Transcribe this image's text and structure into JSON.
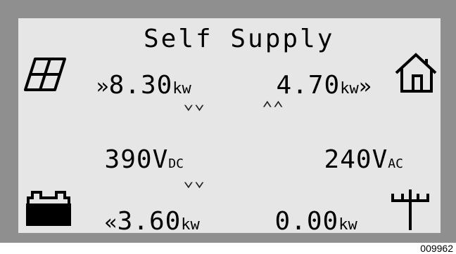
{
  "screen": {
    "title": "Self Supply",
    "solar": {
      "prefix": "»",
      "value": "8.30",
      "unit": "kw"
    },
    "home": {
      "value": "4.70",
      "unit": "kw",
      "suffix": "»"
    },
    "dc": {
      "value": "390",
      "unit_main": "V",
      "unit_sub": "DC"
    },
    "ac": {
      "value": "240",
      "unit_main": "V",
      "unit_sub": "AC"
    },
    "battery": {
      "prefix": "«",
      "value": "3.60",
      "unit": "kw"
    },
    "grid": {
      "value": "0.00",
      "unit": "kw"
    },
    "chevrons": {
      "down": "⌄⌄",
      "up": "⌃⌃"
    }
  },
  "figure_code": "009962",
  "colors": {
    "bezel": "#8f8f8f",
    "lcd": "#e6e6e6",
    "ink": "#000000"
  },
  "icons": [
    "solar-panel-icon",
    "house-icon",
    "battery-icon",
    "utility-pole-icon"
  ]
}
